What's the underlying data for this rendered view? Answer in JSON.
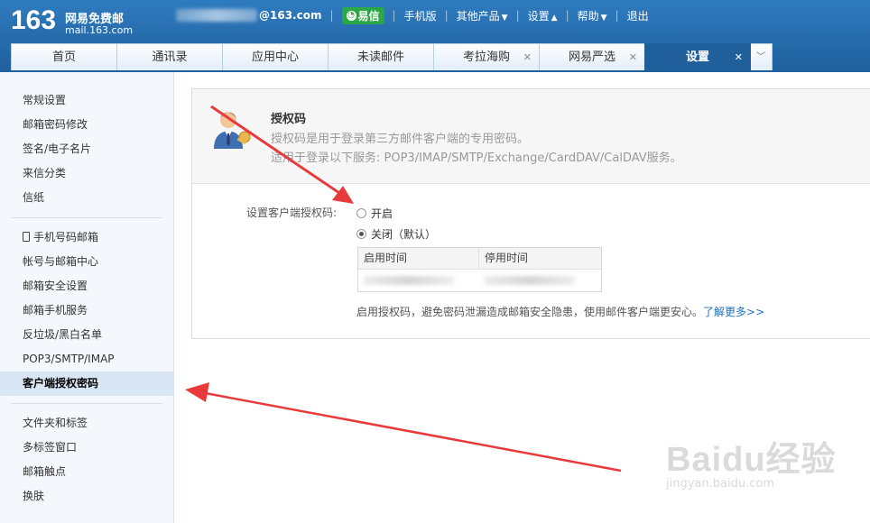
{
  "header": {
    "logo_number": "163",
    "logo_name": "网易免费邮",
    "logo_domain": "mail.163.com",
    "email_suffix": "@163.com",
    "yixin_label": "易信",
    "nav": {
      "mobile": "手机版",
      "other": "其他产品",
      "settings": "设置",
      "help": "帮助",
      "logout": "退出"
    }
  },
  "tabs": [
    {
      "label": "首页",
      "closable": false
    },
    {
      "label": "通讯录",
      "closable": false
    },
    {
      "label": "应用中心",
      "closable": false
    },
    {
      "label": "未读邮件",
      "closable": false
    },
    {
      "label": "考拉海购",
      "closable": true
    },
    {
      "label": "网易严选",
      "closable": true
    },
    {
      "label": "设置",
      "closable": true,
      "active": true
    }
  ],
  "sidebar": {
    "group1": [
      "常规设置",
      "邮箱密码修改",
      "签名/电子名片",
      "来信分类",
      "信纸"
    ],
    "group2": [
      "手机号码邮箱",
      "帐号与邮箱中心",
      "邮箱安全设置",
      "邮箱手机服务",
      "反垃圾/黑白名单",
      "POP3/SMTP/IMAP",
      "客户端授权密码"
    ],
    "group2_active": "客户端授权密码",
    "group3": [
      "文件夹和标签",
      "多标签窗口",
      "邮箱触点",
      "换肤"
    ]
  },
  "main": {
    "title": "授权码",
    "desc1": "授权码是用于登录第三方邮件客户端的专用密码。",
    "desc2": "适用于登录以下服务: POP3/IMAP/SMTP/Exchange/CardDAV/CalDAV服务。",
    "setting_label": "设置客户端授权码:",
    "option_on": "开启",
    "option_off": "关闭（默认）",
    "selected": "关闭（默认）",
    "table_headers": [
      "启用时间",
      "停用时间"
    ],
    "note": "启用授权码，避免密码泄漏造成邮箱安全隐患，使用邮件客户端更安心。",
    "learn_more": "了解更多>>"
  },
  "watermark": {
    "brand": "Baidu经验",
    "url": "jingyan.baidu.com"
  },
  "colors": {
    "header": "#1f5f9c",
    "annotation_arrow": "#e83a3a",
    "link": "#1f6fc0"
  }
}
